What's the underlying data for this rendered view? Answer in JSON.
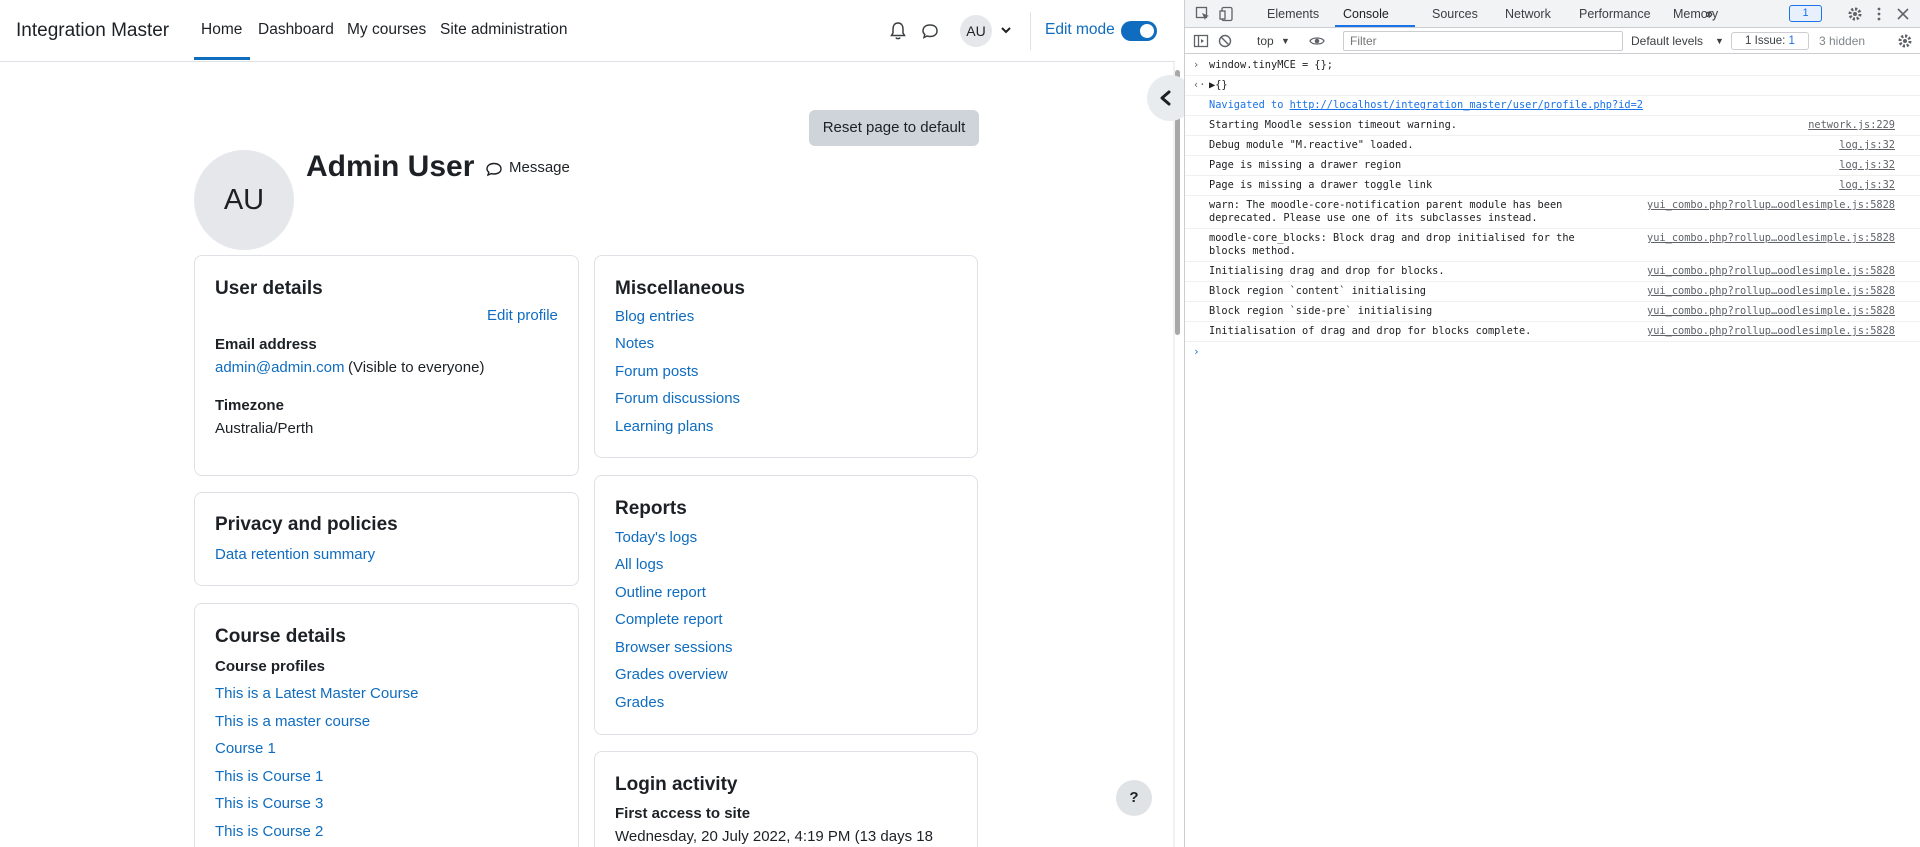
{
  "site": {
    "brand": "Integration Master",
    "nav": [
      "Home",
      "Dashboard",
      "My courses",
      "Site administration"
    ],
    "user_initials": "AU",
    "edit_mode_label": "Edit mode"
  },
  "page": {
    "reset_label": "Reset page to default",
    "avatar_initials": "AU",
    "user_name": "Admin User",
    "message_label": "Message",
    "help_label": "?"
  },
  "user_details": {
    "title": "User details",
    "edit_profile": "Edit profile",
    "email_label": "Email address",
    "email_value": "admin@admin.com",
    "email_visibility": "(Visible to everyone)",
    "timezone_label": "Timezone",
    "timezone_value": "Australia/Perth"
  },
  "privacy": {
    "title": "Privacy and policies",
    "link": "Data retention summary"
  },
  "course_details": {
    "title": "Course details",
    "subtitle": "Course profiles",
    "courses": [
      "This is a Latest Master Course",
      "This is a master course",
      "Course 1",
      "This is Course 1",
      "This is Course 3",
      "This is Course 2"
    ]
  },
  "misc": {
    "title": "Miscellaneous",
    "links": [
      "Blog entries",
      "Notes",
      "Forum posts",
      "Forum discussions",
      "Learning plans"
    ]
  },
  "reports": {
    "title": "Reports",
    "links": [
      "Today's logs",
      "All logs",
      "Outline report",
      "Complete report",
      "Browser sessions",
      "Grades overview",
      "Grades"
    ]
  },
  "login_activity": {
    "title": "Login activity",
    "first_access_label": "First access to site",
    "first_access_value": "Wednesday, 20 July 2022, 4:19 PM  (13 days 18"
  },
  "devtools": {
    "tabs": [
      "Elements",
      "Console",
      "Sources",
      "Network",
      "Performance",
      "Memory",
      "»"
    ],
    "message_badge": "1",
    "context": "top",
    "filter_placeholder": "Filter",
    "levels": "Default levels",
    "issue_label": "1 Issue:",
    "issue_count": "1",
    "hidden": "3 hidden",
    "input_cmd": "window.tinyMCE = {};",
    "input_result": "▶{}",
    "nav_prefix": "Navigated to",
    "nav_url": "http://localhost/integration_master/user/profile.php?id=2",
    "logs": [
      {
        "msg": "Starting Moodle session timeout warning.",
        "src": "network.js:229"
      },
      {
        "msg": "Debug module \"M.reactive\" loaded.",
        "src": "log.js:32"
      },
      {
        "msg": "Page is missing a drawer region",
        "src": "log.js:32"
      },
      {
        "msg": "Page is missing a drawer toggle link",
        "src": "log.js:32"
      },
      {
        "msg": "warn: The moodle-core-notification parent module has been deprecated. Please use one of its subclasses instead.",
        "src": "yui_combo.php?rollup…oodlesimple.js:5828"
      },
      {
        "msg": "moodle-core_blocks: Block drag and drop initialised for the blocks method.",
        "src": "yui_combo.php?rollup…oodlesimple.js:5828"
      },
      {
        "msg": "Initialising drag and drop for blocks.",
        "src": "yui_combo.php?rollup…oodlesimple.js:5828"
      },
      {
        "msg": "Block region `content` initialising",
        "src": "yui_combo.php?rollup…oodlesimple.js:5828"
      },
      {
        "msg": "Block region `side-pre` initialising",
        "src": "yui_combo.php?rollup…oodlesimple.js:5828"
      },
      {
        "msg": "Initialisation of drag and drop for blocks complete.",
        "src": "yui_combo.php?rollup…oodlesimple.js:5828"
      }
    ]
  }
}
